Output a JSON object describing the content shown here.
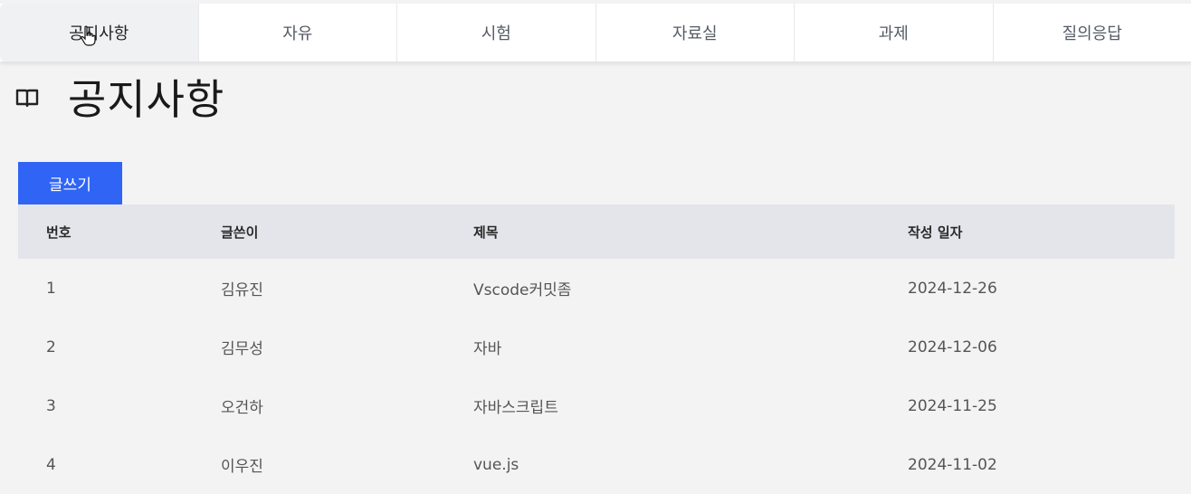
{
  "tabs": [
    {
      "label": "공지사항",
      "active": true
    },
    {
      "label": "자유",
      "active": false
    },
    {
      "label": "시험",
      "active": false
    },
    {
      "label": "자료실",
      "active": false
    },
    {
      "label": "과제",
      "active": false
    },
    {
      "label": "질의응답",
      "active": false
    }
  ],
  "page": {
    "title": "공지사항",
    "icon": "book-open-icon"
  },
  "write_button": {
    "label": "글쓰기",
    "color": "#2f64f5"
  },
  "table": {
    "columns": [
      "번호",
      "글쓴이",
      "제목",
      "작성 일자"
    ],
    "rows": [
      {
        "no": "1",
        "author": "김유진",
        "title": "Vscode커밋좀",
        "date": "2024-12-26"
      },
      {
        "no": "2",
        "author": "김무성",
        "title": "자바",
        "date": "2024-12-06"
      },
      {
        "no": "3",
        "author": "오건하",
        "title": "자바스크립트",
        "date": "2024-11-25"
      },
      {
        "no": "4",
        "author": "이우진",
        "title": "vue.js",
        "date": "2024-11-02"
      }
    ]
  }
}
